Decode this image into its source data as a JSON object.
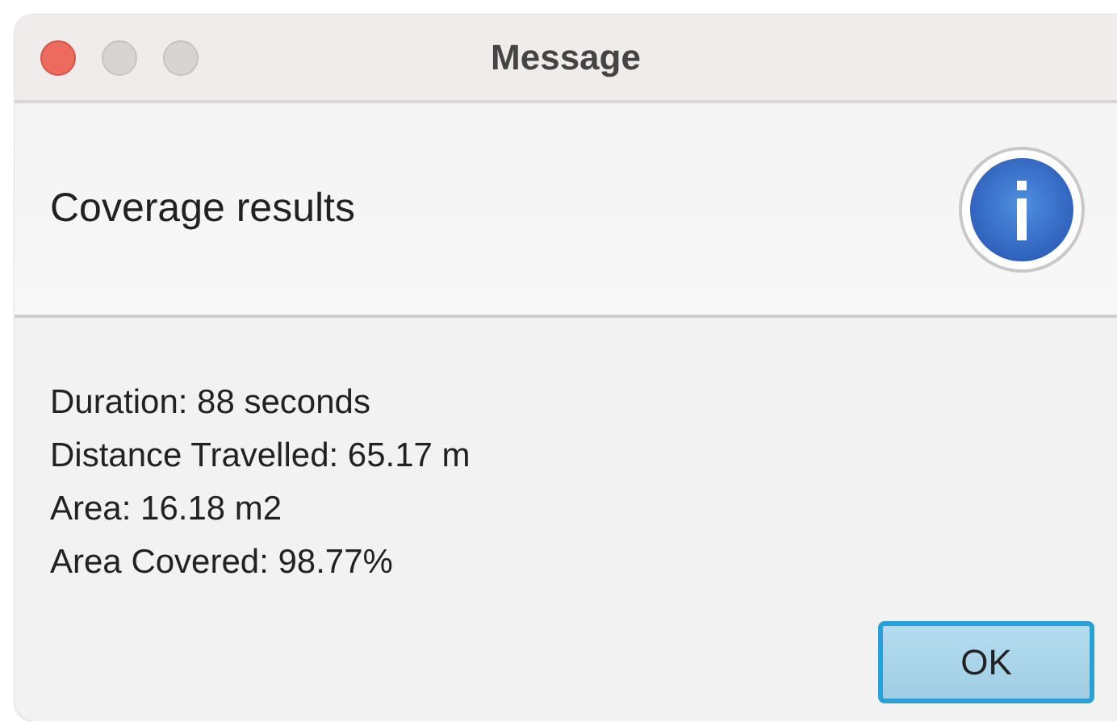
{
  "window": {
    "title": "Message",
    "controls": [
      {
        "kind": "close",
        "disabled": false
      },
      {
        "kind": "minimize",
        "disabled": true
      },
      {
        "kind": "zoom",
        "disabled": true
      }
    ]
  },
  "header": {
    "kind": "info",
    "text": "Coverage results"
  },
  "lines": [
    "Duration: 88 seconds",
    "Distance Travelled: 65.17 m",
    "Area: 16.18 m2",
    "Area Covered: 98.77%"
  ],
  "buttons": [
    {
      "label": "OK",
      "default": true
    }
  ]
}
